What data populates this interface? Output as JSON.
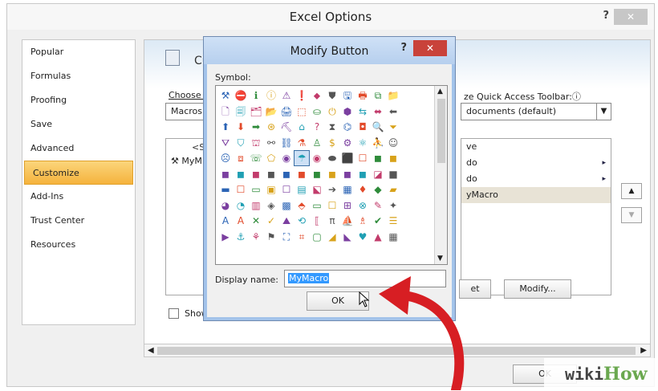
{
  "window": {
    "title": "Excel Options",
    "help": "?",
    "close": "✕"
  },
  "nav": {
    "items": [
      {
        "label": "Popular"
      },
      {
        "label": "Formulas"
      },
      {
        "label": "Proofing"
      },
      {
        "label": "Save"
      },
      {
        "label": "Advanced"
      },
      {
        "label": "Customize",
        "active": true
      },
      {
        "label": "Add-Ins"
      },
      {
        "label": "Trust Center"
      },
      {
        "label": "Resources"
      }
    ]
  },
  "content": {
    "title_partial": "Cu",
    "choose_label_partial": "Choose c",
    "choose_value": "Macros",
    "left_list_separator": "<Se",
    "left_list_item": "MyM",
    "qat_label": "ze Quick Access Toolbar:",
    "qat_info": "ⓘ",
    "qat_value": "documents (default)",
    "right_list": [
      {
        "label": "ve"
      },
      {
        "label": "do",
        "caret": "▸"
      },
      {
        "label": "do",
        "caret": "▸"
      },
      {
        "label": "yMacro",
        "selected": true
      }
    ],
    "reset_button": "et",
    "modify_button": "Modify...",
    "up_button": "▲",
    "down_button": "▼",
    "show_label": "Show",
    "ok_button": "OK",
    "hscroll_left": "◀",
    "hscroll_right": "▶"
  },
  "modal": {
    "title": "Modify Button",
    "help": "?",
    "close": "✕",
    "symbol_label": "Symbol:",
    "symbols": [
      "⚒",
      "⛔",
      "ℹ",
      "ⓘ",
      "⚠",
      "❗",
      "⬥",
      "⛊",
      "🖫",
      "🖶",
      "⧉",
      "📁",
      "🗋",
      "🗐",
      "🗂",
      "📂",
      "🖨",
      "⬚",
      "⛀",
      "⏻",
      "⬢",
      "⇆",
      "⬌",
      "⬅",
      "⬆",
      "⬇",
      "➡",
      "⊛",
      "⛏",
      "⌂",
      "?",
      "⧗",
      "⌬",
      "◘",
      "🔍",
      "⏷",
      "⛛",
      "⛉",
      "⛫",
      "⚯",
      "⛓",
      "⚗",
      "♙",
      "$",
      "⚙",
      "⚛",
      "⛹",
      "☺",
      "☹",
      "⧈",
      "☏",
      "⬠",
      "◉",
      "☂",
      "◉",
      "⬬",
      "⬛",
      "☐",
      "◼",
      "◼",
      "◼",
      "◼",
      "◼",
      "◼",
      "◼",
      "◼",
      "◼",
      "◼",
      "◼",
      "◼",
      "◪",
      "■",
      "▬",
      "☐",
      "▭",
      "▣",
      "☐",
      "▤",
      "⬕",
      "➔",
      "▦",
      "♦",
      "◆",
      "▰",
      "◕",
      "◔",
      "▥",
      "◈",
      "▩",
      "⬘",
      "▭",
      "☐",
      "⊞",
      "⊗",
      "✎",
      "✦",
      "A",
      "A",
      "✕",
      "✓",
      "⛰",
      "⟲",
      "⟦",
      "π",
      "⛵",
      "♗",
      "✔",
      "☰",
      "▶",
      "⚓",
      "⚘",
      "⚑",
      "⛶",
      "⌗",
      "▢",
      "◢",
      "◣",
      "♥",
      "▲",
      "▦"
    ],
    "selected_symbol_index": 53,
    "display_name_label": "Display name:",
    "display_name_value": "MyMacro",
    "ok_button": "OK",
    "scroll_up": "▲",
    "scroll_down": "▼"
  },
  "watermark": {
    "wiki": "wiki",
    "how": "How"
  }
}
